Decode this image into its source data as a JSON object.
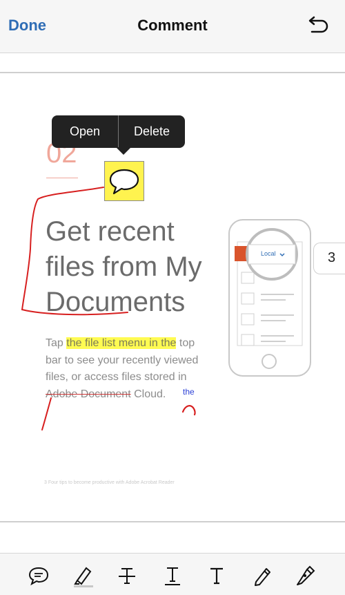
{
  "header": {
    "done_label": "Done",
    "title": "Comment"
  },
  "popup": {
    "open_label": "Open",
    "delete_label": "Delete"
  },
  "document": {
    "number": "02",
    "heading_lines": [
      "Get recent",
      "files from My",
      "Documents"
    ],
    "body": {
      "part1": "Tap",
      "highlight": "the file list menu in the",
      "part2": "top bar to see your recently viewed files, or access files stored in",
      "struck": "Adobe Document",
      "part3": "Cloud."
    },
    "insert_text": "the",
    "footer": "3  Four tips to become productive with Adobe Acrobat Reader",
    "phone_menu_label": "Local"
  },
  "page_indicator": "3",
  "toolbar_icons": [
    "comment-icon",
    "highlighter-icon",
    "strikethrough-icon",
    "underline-icon",
    "text-icon",
    "pencil-icon",
    "signature-pen-icon"
  ],
  "colors": {
    "accent": "#2f6db5",
    "ink": "#d71f1f",
    "highlight": "#fffb52",
    "note": "#fff34f"
  }
}
